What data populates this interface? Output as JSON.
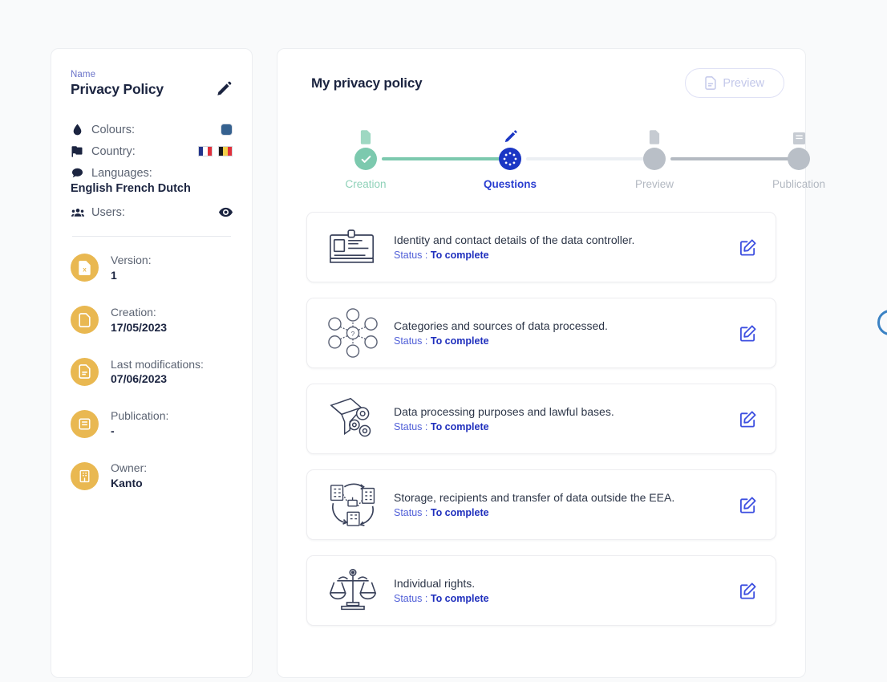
{
  "sidebar": {
    "name_label": "Name",
    "name_value": "Privacy Policy",
    "edit_name_icon": "pencil-icon",
    "meta": [
      {
        "icon": "droplet-icon",
        "label": "Colours:",
        "swatch_color": "#35618f"
      },
      {
        "icon": "flag-icon",
        "label": "Country:",
        "flags": [
          "France",
          "Belgium"
        ]
      },
      {
        "icon": "speech-bubble-icon",
        "label": "Languages:",
        "value": "English French Dutch"
      },
      {
        "icon": "users-icon",
        "label": "Users:",
        "action_icon": "eye-icon"
      }
    ],
    "info": [
      {
        "icon": "file-version-icon",
        "key": "Version:",
        "value": "1"
      },
      {
        "icon": "file-blank-icon",
        "key": "Creation:",
        "value": "17/05/2023"
      },
      {
        "icon": "file-edit-icon",
        "key": "Last modifications:",
        "value": "07/06/2023"
      },
      {
        "icon": "book-icon",
        "key": "Publication:",
        "value": "-"
      },
      {
        "icon": "building-icon",
        "key": "Owner:",
        "value": "Kanto"
      }
    ]
  },
  "main": {
    "title": "My privacy policy",
    "preview_button": {
      "label": "Preview",
      "icon": "document-icon",
      "disabled": true
    },
    "stepper": [
      {
        "label": "Creation",
        "state": "done",
        "icon": "document-icon"
      },
      {
        "label": "Questions",
        "state": "active",
        "icon": "pencil-icon"
      },
      {
        "label": "Preview",
        "state": "todo",
        "icon": "document-search-icon"
      },
      {
        "label": "Publication",
        "state": "todo",
        "icon": "book-icon"
      }
    ],
    "status_prefix": "Status : ",
    "questions": [
      {
        "icon": "id-card-icon",
        "title": "Identity and contact details of the data controller.",
        "status": "To complete",
        "edit_icon": "edit-square-icon"
      },
      {
        "icon": "data-network-icon",
        "title": "Categories and sources of data processed.",
        "status": "To complete",
        "edit_icon": "edit-square-icon"
      },
      {
        "icon": "funnel-gears-icon",
        "title": "Data processing purposes and lawful bases.",
        "status": "To complete",
        "edit_icon": "edit-square-icon"
      },
      {
        "icon": "buildings-transfer-icon",
        "title": "Storage, recipients and transfer of data outside the EEA.",
        "status": "To complete",
        "edit_icon": "edit-square-icon"
      },
      {
        "icon": "scales-icon",
        "title": "Individual rights.",
        "status": "To complete",
        "edit_icon": "edit-square-icon"
      }
    ]
  },
  "colors": {
    "accent_blue": "#2a3ed0",
    "done_green": "#7cc9ae",
    "badge_yellow": "#e9b851",
    "muted_gray": "#b2b8c1",
    "edge_circle": "#3b82c4"
  }
}
